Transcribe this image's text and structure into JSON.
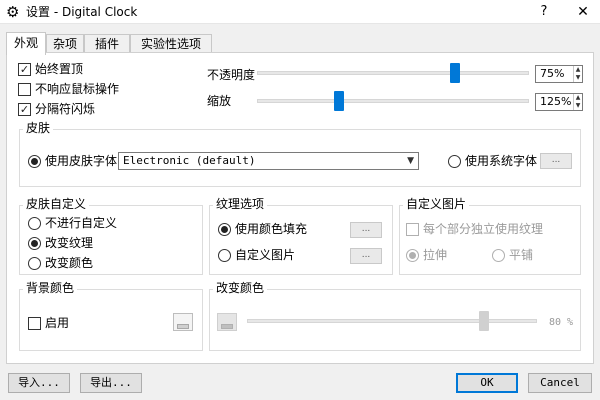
{
  "window": {
    "title": "设置 - Digital Clock",
    "icon": "gear-icon",
    "help_label": "?",
    "close_label": "✕"
  },
  "tabs": [
    {
      "label": "外观",
      "active": true
    },
    {
      "label": "杂项",
      "active": false
    },
    {
      "label": "插件",
      "active": false
    },
    {
      "label": "实验性选项",
      "active": false
    }
  ],
  "options": {
    "always_on_top": {
      "label": "始终置顶",
      "checked": true
    },
    "ignore_mouse": {
      "label": "不响应鼠标操作",
      "checked": false
    },
    "separator_blink": {
      "label": "分隔符闪烁",
      "checked": true
    }
  },
  "opacity": {
    "label": "不透明度",
    "value": "75%",
    "level": 0.75
  },
  "zoom": {
    "label": "缩放",
    "value": "125%",
    "level": 0.3
  },
  "skin": {
    "title": "皮肤",
    "use_skin_font_label": "使用皮肤字体",
    "use_skin_font_selected": true,
    "selected_skin": "Electronic (default)",
    "use_system_font_label": "使用系统字体",
    "use_system_font_selected": false,
    "font_button_label": "..."
  },
  "skin_custom": {
    "title": "皮肤自定义",
    "options": [
      {
        "label": "不进行自定义",
        "selected": false
      },
      {
        "label": "改变纹理",
        "selected": true
      },
      {
        "label": "改变颜色",
        "selected": false
      }
    ]
  },
  "texture": {
    "title": "纹理选项",
    "color_fill_label": "使用颜色填充",
    "color_fill_selected": true,
    "custom_image_label": "自定义图片",
    "custom_image_selected": false,
    "button_label": "..."
  },
  "custom_image": {
    "title": "自定义图片",
    "per_part_label": "每个部分独立使用纹理",
    "stretch_label": "拉伸",
    "stretch_selected": true,
    "tile_label": "平铺",
    "tile_selected": false
  },
  "background_color": {
    "title": "背景颜色",
    "enable_label": "启用",
    "enabled": false
  },
  "change_color": {
    "title": "改变颜色",
    "value": "80 %",
    "level": 0.8
  },
  "buttons": {
    "import": "导入...",
    "export": "导出...",
    "ok": "OK",
    "cancel": "Cancel"
  }
}
